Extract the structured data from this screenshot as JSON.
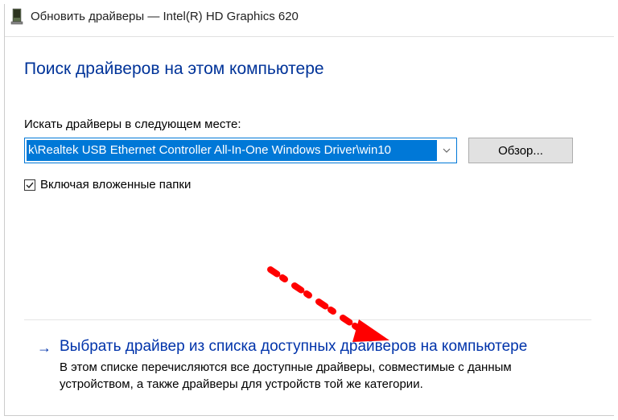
{
  "titlebar": {
    "title": "Обновить драйверы — Intel(R) HD Graphics 620"
  },
  "heading": "Поиск драйверов на этом компьютере",
  "path": {
    "label": "Искать драйверы в следующем месте:",
    "value": "k\\Realtek USB Ethernet Controller All-In-One Windows Driver\\win10",
    "browse_label": "Обзор..."
  },
  "checkbox": {
    "checked": true,
    "label": "Включая вложенные папки"
  },
  "action": {
    "title": "Выбрать драйвер из списка доступных драйверов на компьютере",
    "desc": "В этом списке перечисляются все доступные драйверы, совместимые с данным устройством, а также драйверы для устройств той же категории."
  }
}
